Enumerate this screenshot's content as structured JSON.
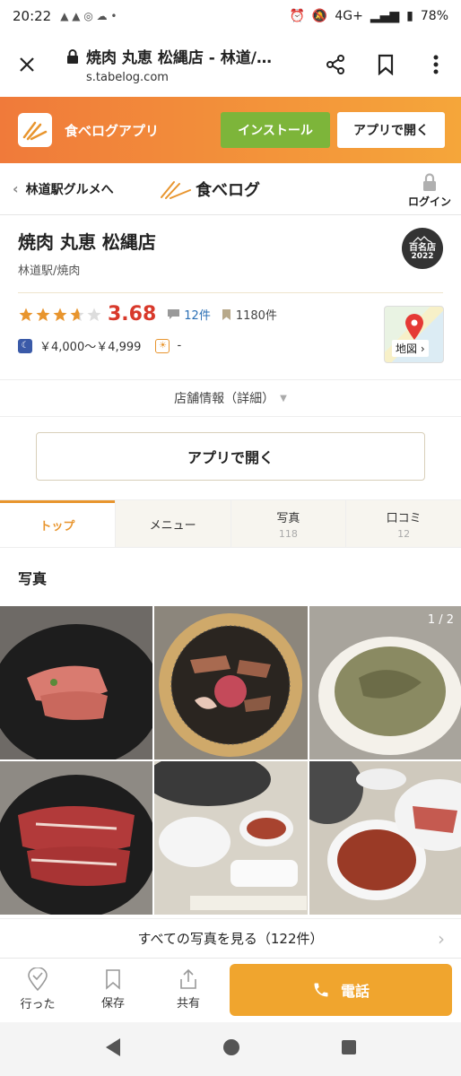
{
  "status_bar": {
    "time": "20:22",
    "network": "4G+",
    "battery": "78%"
  },
  "browser": {
    "page_title": "焼肉 丸恵 松縄店 - 林道/…",
    "url": "s.tabelog.com"
  },
  "app_banner": {
    "app_name": "食べログアプリ",
    "install_label": "インストール",
    "open_label": "アプリで開く"
  },
  "site_header": {
    "back_label": "林道駅グルメへ",
    "logo_text": "食べログ",
    "login_label": "ログイン"
  },
  "restaurant": {
    "name": "焼肉 丸恵 松縄店",
    "area_genre": "林道駅/焼肉",
    "badge_line1": "百名店",
    "badge_year": "2022",
    "rating": "3.68",
    "rating_value": 3.68,
    "review_count": "12件",
    "save_count": "1180件",
    "dinner_price": "￥4,000〜￥4,999",
    "lunch_price": "-",
    "map_label": "地図",
    "details_label": "店舗情報（詳細）"
  },
  "open_app_button": "アプリで開く",
  "tabs": [
    {
      "label": "トップ",
      "count": ""
    },
    {
      "label": "メニュー",
      "count": ""
    },
    {
      "label": "写真",
      "count": "118"
    },
    {
      "label": "口コミ",
      "count": "12"
    }
  ],
  "photos": {
    "heading": "写真",
    "counter": "1 / 2",
    "see_all_label": "すべての写真を見る（122件）"
  },
  "action_bar": {
    "visited_label": "行った",
    "save_label": "保存",
    "share_label": "共有",
    "call_label": "電話"
  },
  "colors": {
    "accent": "#f0a52e",
    "rating_red": "#d8392b",
    "install_green": "#7db53a"
  }
}
